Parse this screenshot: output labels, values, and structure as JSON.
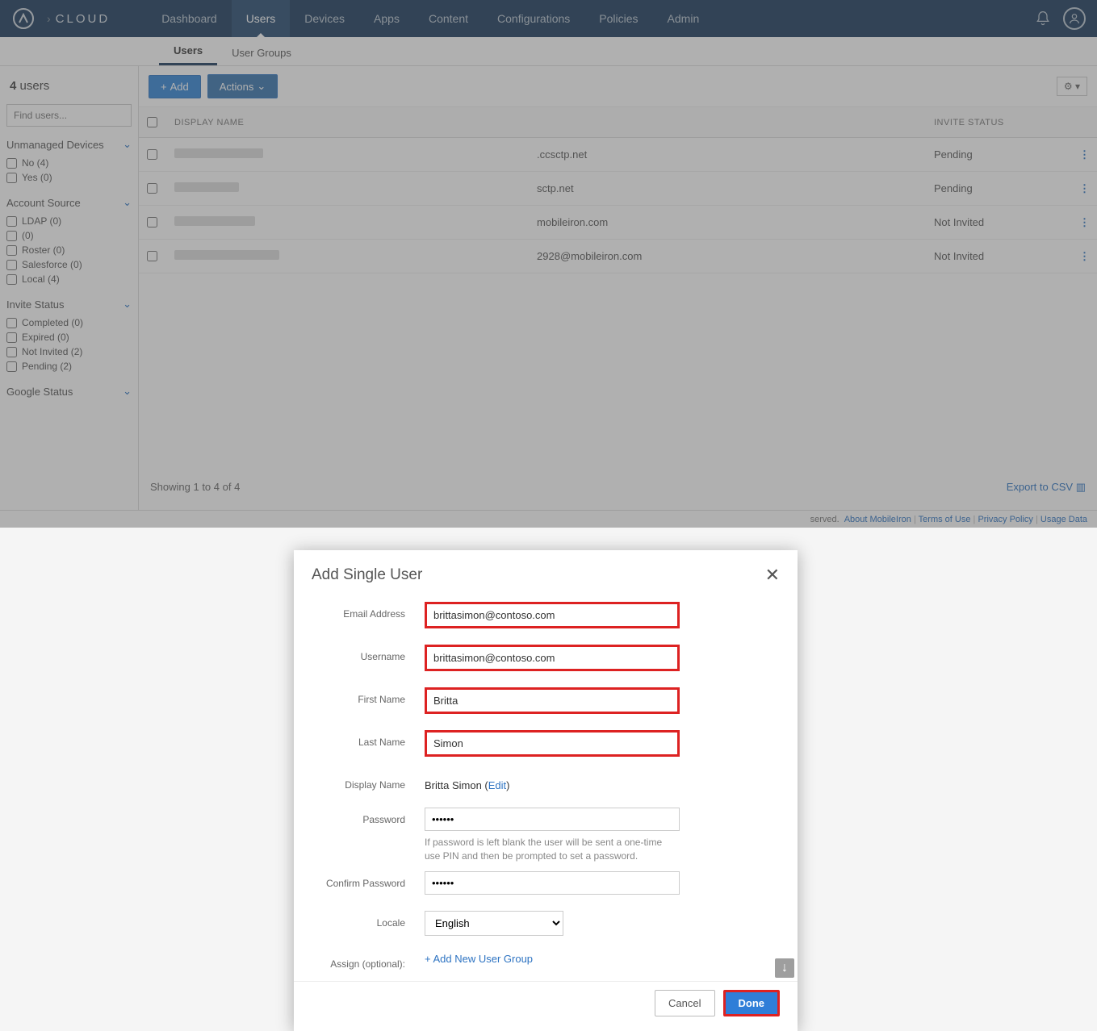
{
  "brand": {
    "text": "CLOUD"
  },
  "nav": {
    "items": [
      "Dashboard",
      "Users",
      "Devices",
      "Apps",
      "Content",
      "Configurations",
      "Policies",
      "Admin"
    ],
    "activeIndex": 1
  },
  "subnav": {
    "items": [
      "Users",
      "User Groups"
    ],
    "activeIndex": 0
  },
  "sidebar": {
    "count_prefix": "4",
    "count_word": "users",
    "search_placeholder": "Find users...",
    "facets": [
      {
        "title": "Unmanaged Devices",
        "items": [
          "No (4)",
          "Yes (0)"
        ]
      },
      {
        "title": "Account Source",
        "items": [
          "LDAP (0)",
          " (0)",
          "Roster (0)",
          "Salesforce (0)",
          "Local (4)"
        ]
      },
      {
        "title": "Invite Status",
        "items": [
          "Completed (0)",
          "Expired (0)",
          "Not Invited (2)",
          "Pending (2)"
        ]
      },
      {
        "title": "Google Status",
        "items": []
      }
    ]
  },
  "toolbar": {
    "add": "Add",
    "actions": "Actions"
  },
  "table": {
    "headers": {
      "name": "DISPLAY NAME",
      "status": "INVITE STATUS"
    },
    "rows": [
      {
        "email_frag": ".ccsctp.net",
        "status": "Pending"
      },
      {
        "email_frag": "sctp.net",
        "status": "Pending"
      },
      {
        "email_frag": "mobileiron.com",
        "status": "Not Invited"
      },
      {
        "email_frag": "2928@mobileiron.com",
        "status": "Not Invited"
      }
    ],
    "footer": "Showing 1 to 4 of 4",
    "export": "Export to CSV"
  },
  "footer_links": [
    "About MobileIron",
    "Terms of Use",
    "Privacy Policy",
    "Usage Data"
  ],
  "footer_reserved": "served.",
  "modal": {
    "title": "Add Single User",
    "fields": {
      "email": {
        "label": "Email Address",
        "value": "brittasimon@contoso.com"
      },
      "username": {
        "label": "Username",
        "value": "brittasimon@contoso.com"
      },
      "firstname": {
        "label": "First Name",
        "value": "Britta"
      },
      "lastname": {
        "label": "Last Name",
        "value": "Simon"
      },
      "displayname": {
        "label": "Display Name",
        "value": "Britta Simon",
        "edit": "Edit"
      },
      "password": {
        "label": "Password",
        "hint": "If password is left blank the user will be sent a one-time use PIN and then be prompted to set a password."
      },
      "confirm": {
        "label": "Confirm Password"
      },
      "locale": {
        "label": "Locale",
        "value": "English"
      },
      "assign": {
        "label": "Assign (optional):",
        "link": "+ Add New User Group"
      }
    },
    "buttons": {
      "cancel": "Cancel",
      "done": "Done"
    }
  }
}
